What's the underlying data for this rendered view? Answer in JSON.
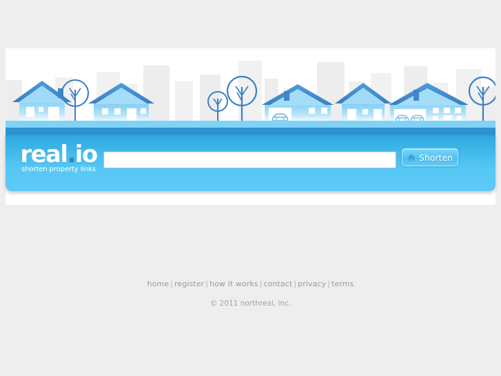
{
  "site": {
    "logo_text": "real",
    "logo_dot": ".",
    "logo_suffix": "io",
    "tagline": "shorten property links"
  },
  "search": {
    "input_value": "",
    "placeholder": "",
    "button_label": "Shorten",
    "button_icon": "home-icon"
  },
  "footer": {
    "links": [
      {
        "label": "home"
      },
      {
        "label": "register"
      },
      {
        "label": "how it works"
      },
      {
        "label": "contact"
      },
      {
        "label": "privacy"
      },
      {
        "label": "terms"
      }
    ],
    "separator": "|",
    "copyright": "© 2011 northreal, inc."
  },
  "banner": {
    "description": "illustration of suburban houses with trees, cars and city skyline",
    "colors": {
      "page_background": "#eeeeee",
      "sheet_background": "#ffffff",
      "sky": "#ffffff",
      "skyline_building": "#f0f0f0",
      "skyline_building_alt": "#f5f5f5",
      "roof_dark": "#3f86c8",
      "roof_mid": "#4f9ada",
      "house_body_top": "#8fd4f5",
      "house_body_bottom": "#ffffff",
      "house_outline": "#5bb8ea",
      "tree_outline": "#3a7fc4",
      "ground_light": "#7fd3f7",
      "ground_stripe": "#2e93cf",
      "panel_top": "#2ba6dd",
      "panel_bottom": "#5ec9f7",
      "button_blue": "#5bc5f3",
      "logo_dot": "#3a7fc4",
      "footer_text": "#9a9a9a"
    }
  }
}
